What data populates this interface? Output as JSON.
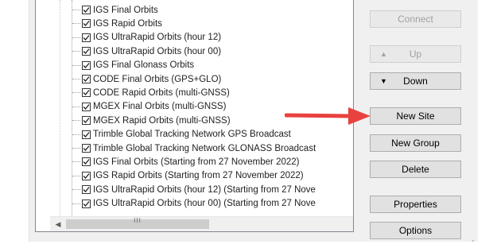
{
  "tree": {
    "items": [
      {
        "label": "IGS Final Orbits",
        "checked": true
      },
      {
        "label": "IGS Rapid Orbits",
        "checked": true
      },
      {
        "label": "IGS UltraRapid Orbits (hour 12)",
        "checked": true
      },
      {
        "label": "IGS UltraRapid Orbits (hour 00)",
        "checked": true
      },
      {
        "label": "IGS Final Glonass Orbits",
        "checked": true
      },
      {
        "label": "CODE Final Orbits (GPS+GLO)",
        "checked": true
      },
      {
        "label": "CODE Rapid Orbits (multi-GNSS)",
        "checked": true
      },
      {
        "label": "MGEX Final Orbits (multi-GNSS)",
        "checked": true
      },
      {
        "label": "MGEX Rapid Orbits (multi-GNSS)",
        "checked": true
      },
      {
        "label": "Trimble Global Tracking Network GPS Broadcast",
        "checked": true
      },
      {
        "label": "Trimble Global Tracking Network GLONASS Broadcast",
        "checked": true
      },
      {
        "label": "IGS Final Orbits (Starting from 27 November 2022)",
        "checked": true
      },
      {
        "label": "IGS Rapid Orbits (Starting from 27 November 2022)",
        "checked": true
      },
      {
        "label": "IGS UltraRapid Orbits (hour 12) (Starting from 27 Nove",
        "checked": true
      },
      {
        "label": "IGS UltraRapid Orbits (hour 00) (Starting from 27 Nove",
        "checked": true
      }
    ],
    "hscroll_glyph": "III"
  },
  "buttons": {
    "connect": "Connect",
    "up": "Up",
    "down": "Down",
    "new_site": "New Site",
    "new_group": "New Group",
    "delete": "Delete",
    "properties": "Properties",
    "options": "Options"
  },
  "colors": {
    "annotation_arrow": "#e8423f",
    "panel_bg": "#f0f0f0",
    "button_bg": "#e1e1e1",
    "disabled_text": "#a0a0a0"
  }
}
